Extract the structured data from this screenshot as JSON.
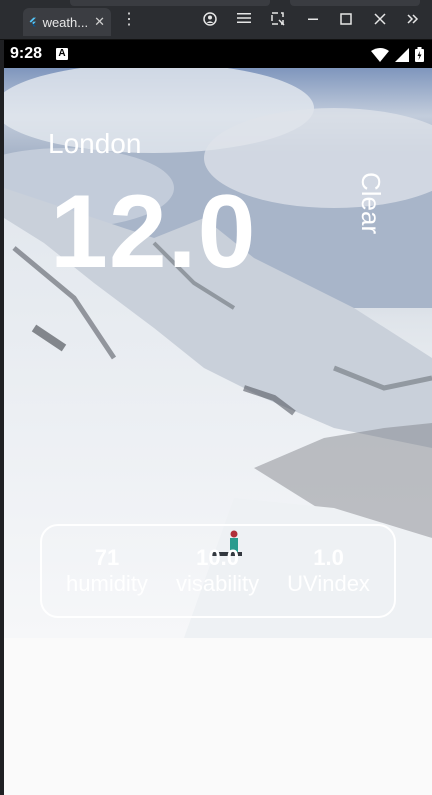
{
  "browser": {
    "tab_title": "weath...",
    "tab_close": "✕",
    "menu_glyph": "⋮"
  },
  "status_bar": {
    "time": "9:28",
    "a_icon": "A"
  },
  "weather": {
    "city": "London",
    "temperature": "12.0",
    "condition": "Clear",
    "stats": [
      {
        "value": "71",
        "label": "humidity"
      },
      {
        "value": "10.0",
        "label": "visability"
      },
      {
        "value": "1.0",
        "label": "UVindex"
      }
    ]
  },
  "colors": {
    "browser_bar": "#2b2d31",
    "status_bar": "#000000",
    "text_on_image": "#ffffff",
    "page_background": "#fafafa"
  }
}
